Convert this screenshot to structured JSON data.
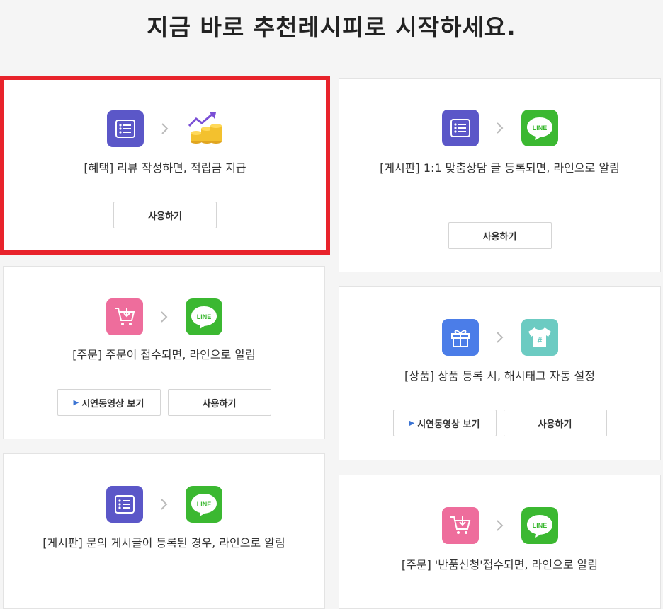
{
  "header": {
    "title": "지금 바로 추천레시피로 시작하세요."
  },
  "recipes": [
    {
      "title": "[혜택] 리뷰 작성하면, 적립금 지급",
      "from_icon": "board-list-icon",
      "to_icon": "coins-growth-icon",
      "use_label": "사용하기",
      "highlighted": true
    },
    {
      "title": "[게시판] 1:1 맞춤상담 글 등록되면, 라인으로 알림",
      "from_icon": "board-list-icon",
      "to_icon": "line-icon",
      "use_label": "사용하기"
    },
    {
      "title": "[주문] 주문이 접수되면, 라인으로 알림",
      "from_icon": "cart-icon",
      "to_icon": "line-icon",
      "video_label": "시연동영상 보기",
      "use_label": "사용하기"
    },
    {
      "title": "[상품] 상품 등록 시, 해시태그 자동 설정",
      "from_icon": "gift-icon",
      "to_icon": "tshirt-hashtag-icon",
      "video_label": "시연동영상 보기",
      "use_label": "사용하기"
    },
    {
      "title": "[게시판] 문의 게시글이 등록된 경우, 라인으로 알림",
      "from_icon": "board-list-icon",
      "to_icon": "line-icon"
    },
    {
      "title": "[주문] '반품신청'접수되면, 라인으로 알림",
      "from_icon": "cart-icon",
      "to_icon": "line-icon"
    }
  ],
  "icons": {
    "line_text": "LINE",
    "hashtag": "#"
  },
  "colors": {
    "highlight_border": "#e8232b",
    "board_icon": "#5b57c8",
    "line_icon": "#3bb831",
    "cart_icon": "#ee6d9c",
    "gift_icon": "#4b7de8",
    "tshirt_icon": "#6ccbc2",
    "play_triangle": "#3c74d3"
  }
}
